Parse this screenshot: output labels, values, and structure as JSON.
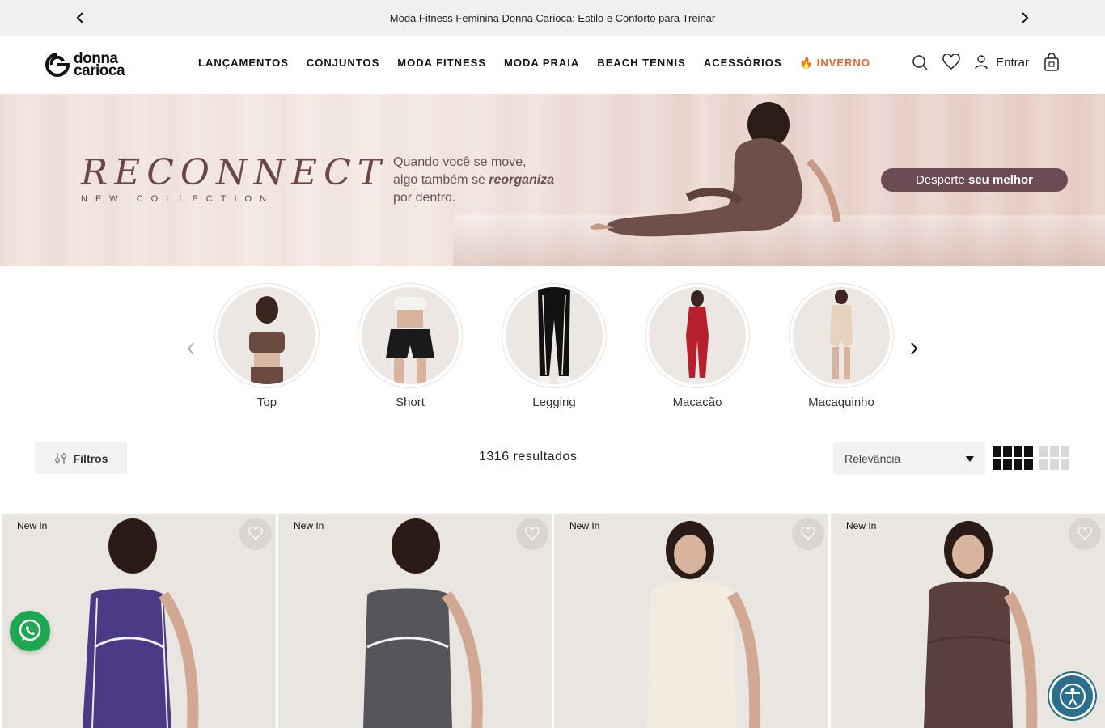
{
  "announcement": {
    "text": "Moda Fitness Feminina Donna Carioca: Estilo e Conforto para Treinar"
  },
  "brand": {
    "line1": "donna",
    "line2": "carioca"
  },
  "nav": {
    "items": [
      {
        "label": "LANÇAMENTOS"
      },
      {
        "label": "CONJUNTOS"
      },
      {
        "label": "MODA FITNESS"
      },
      {
        "label": "MODA PRAIA"
      },
      {
        "label": "BEACH TENNIS"
      },
      {
        "label": "ACESSÓRIOS"
      },
      {
        "label": "INVERNO",
        "icon": "fire-icon",
        "color": "#e8632b"
      }
    ]
  },
  "header": {
    "login_label": "Entrar"
  },
  "banner": {
    "headline": "RECONNECT",
    "subline": "NEW COLLECTION",
    "tagline_line1": "Quando você se move,",
    "tagline_line2_prefix": "algo também se ",
    "tagline_line2_emphasis": "reorganiza",
    "tagline_line3": "por dentro.",
    "cta_prefix": "Desperte ",
    "cta_emphasis": "seu melhor"
  },
  "categories": [
    {
      "label": "Top",
      "color": "#6b4a40"
    },
    {
      "label": "Short",
      "color": "#1a1a1a"
    },
    {
      "label": "Legging",
      "color": "#111111"
    },
    {
      "label": "Macacão",
      "color": "#b81f2e"
    },
    {
      "label": "Macaquinho",
      "color": "#e6d2bd"
    }
  ],
  "toolbar": {
    "filter_label": "Filtros",
    "results_text": "1316 resultados",
    "sort_selected": "Relevância"
  },
  "products": [
    {
      "tag": "New In",
      "color": "#4b3a86"
    },
    {
      "tag": "New In",
      "color": "#55565c"
    },
    {
      "tag": "New In",
      "color": "#f1ebe0"
    },
    {
      "tag": "New In",
      "color": "#5b3f3c"
    }
  ],
  "colors": {
    "accent": "#e8632b",
    "banner_cta": "#6b4c55",
    "whatsapp": "#1fa651",
    "accessibility": "#2c6f8c"
  }
}
